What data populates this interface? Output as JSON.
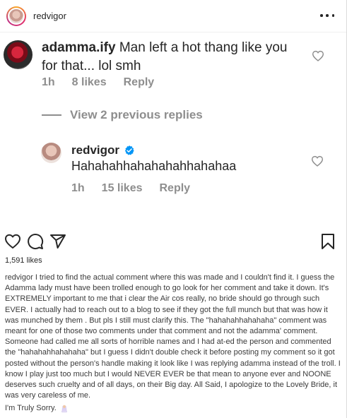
{
  "header": {
    "username": "redvigor"
  },
  "comment_screenshot": {
    "comment": {
      "username": "adamma.ify",
      "text": "Man left a hot thang like you for that... lol smh",
      "time": "1h",
      "likes": "8 likes",
      "reply": "Reply"
    },
    "view_replies": "View 2 previous replies",
    "reply": {
      "username": "redvigor",
      "text": "Hahahahhahahahahhahahaa",
      "time": "1h",
      "likes": "15 likes",
      "reply": "Reply"
    }
  },
  "actions": {
    "icons": [
      "heart-icon",
      "comment-icon",
      "share-icon",
      "bookmark-icon"
    ]
  },
  "likes_count": "1,591 likes",
  "caption": {
    "username": "redvigor",
    "text": "I tried to find the actual comment where this was made and I couldn't find it. I guess the Adamma lady must have been trolled enough to go look for her comment and take it down. It's EXTREMELY important to me that i clear the Air cos really, no bride should go through such EVER. I actually had to reach out to a blog to see if they got the full munch but that was how it was munched by them . But pls I still must clarify this. The \"hahahahhahahaha\" comment was meant for one of those two comments under that comment and not the adamma' comment. Someone had called me all sorts of horrible names and I had at-ed the person and commented the \"hahahahhahahaha\" but I guess I didn't double check it before posting my comment so it got posted without the person's handle making it look like I was replying adamma instead of the troll. I know I play just too much but I would NEVER EVER be that mean to anyone ever and NOONE deserves such cruelty and of all days, on their Big day. All Said, I apologize to the Lovely Bride, it was very careless of me.",
    "signoff": "I'm Truly Sorry."
  },
  "colors": {
    "text": "#262626",
    "muted": "#8e8e8e",
    "verified": "#0095f6"
  }
}
